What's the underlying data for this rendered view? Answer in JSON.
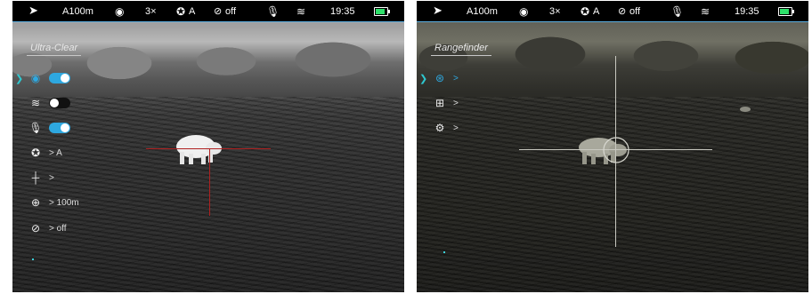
{
  "panels": [
    {
      "status": {
        "range": "A100m",
        "zoom": "3×",
        "shutter": "A",
        "pip": "off",
        "time": "19:35"
      },
      "mode_label": "Ultra-Clear",
      "menu": [
        {
          "icon": "eye-icon",
          "toggle": "on"
        },
        {
          "icon": "wifi-icon",
          "toggle": "off"
        },
        {
          "icon": "microphone-icon",
          "toggle": "on"
        },
        {
          "icon": "shutter-icon",
          "value": "> A"
        },
        {
          "icon": "reticle-icon",
          "value": ">"
        },
        {
          "icon": "crosshair-target-icon",
          "value": "> 100m"
        },
        {
          "icon": "pip-off-icon",
          "value": "> off"
        }
      ]
    },
    {
      "status": {
        "range": "A100m",
        "zoom": "3×",
        "shutter": "A",
        "pip": "off",
        "time": "19:35"
      },
      "mode_label": "Rangefinder",
      "menu": [
        {
          "icon": "rangefinder-icon",
          "value": ">"
        },
        {
          "icon": "add-box-icon",
          "value": ">"
        },
        {
          "icon": "settings-gear-icon",
          "value": ">"
        }
      ]
    }
  ],
  "colors": {
    "accent": "#2ea8e0",
    "battery": "#2ee06a",
    "reticle_red": "#b02020"
  }
}
